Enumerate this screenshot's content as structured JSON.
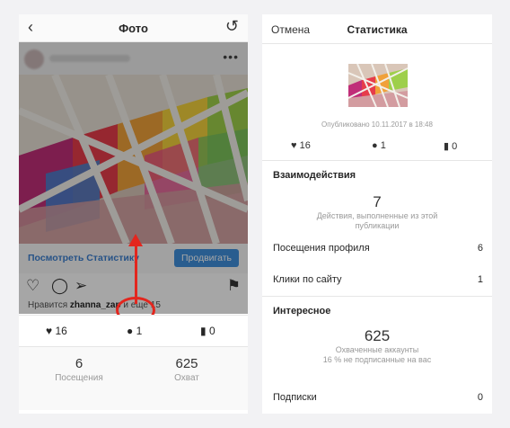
{
  "left": {
    "title": "Фото",
    "back_icon": "chevron-left-icon",
    "undo_icon": "rotate-icon",
    "more": "•••",
    "stats_link": "Посмотреть Статистику",
    "promote": "Продвигать",
    "likes_prefix": "Нравится ",
    "likes_user": "zhanna_zap",
    "likes_suffix": " и еще 15",
    "counts": {
      "likes": "16",
      "comments": "1",
      "saves": "0"
    },
    "bottom": [
      {
        "value": "6",
        "label": "Посещения"
      },
      {
        "value": "625",
        "label": "Охват"
      }
    ]
  },
  "right": {
    "cancel": "Отмена",
    "title": "Статистика",
    "published": "Опубликовано 10.11.2017 в 18:48",
    "counts": {
      "likes": "16",
      "comments": "1",
      "saves": "0"
    },
    "interactions": {
      "title": "Взаимодействия",
      "value": "7",
      "caption": "Действия, выполненные из этой публикации",
      "rows": [
        {
          "label": "Посещения профиля",
          "value": "6"
        },
        {
          "label": "Клики по сайту",
          "value": "1"
        }
      ]
    },
    "interesting": {
      "title": "Интересное",
      "value": "625",
      "caption1": "Охваченные аккаунты",
      "caption2": "16 % не подписанные на вас",
      "rows": [
        {
          "label": "Подписки",
          "value": "0"
        }
      ]
    }
  }
}
